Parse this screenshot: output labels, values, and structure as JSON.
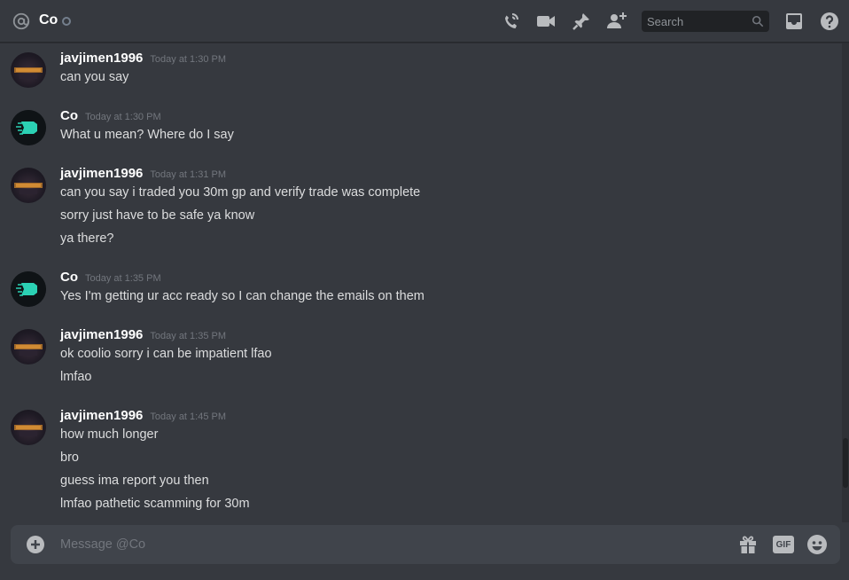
{
  "header": {
    "channel_name": "Co",
    "search_placeholder": "Search"
  },
  "messages": [
    {
      "author": "javjimen1996",
      "avatar": "jav",
      "timestamp": "Today at 1:30 PM",
      "lines": [
        "can you say"
      ]
    },
    {
      "author": "Co",
      "avatar": "co",
      "timestamp": "Today at 1:30 PM",
      "lines": [
        "What u mean? Where do I say"
      ]
    },
    {
      "author": "javjimen1996",
      "avatar": "jav",
      "timestamp": "Today at 1:31 PM",
      "lines": [
        "can you say i traded you 30m gp and verify trade was complete",
        "sorry just have to be safe ya know",
        "ya there?"
      ]
    },
    {
      "author": "Co",
      "avatar": "co",
      "timestamp": "Today at 1:35 PM",
      "lines": [
        "Yes I'm getting ur acc ready so I can change the emails on them"
      ]
    },
    {
      "author": "javjimen1996",
      "avatar": "jav",
      "timestamp": "Today at 1:35 PM",
      "lines": [
        "ok coolio sorry i can be impatient lfao",
        "lmfao"
      ]
    },
    {
      "author": "javjimen1996",
      "avatar": "jav",
      "timestamp": "Today at 1:45 PM",
      "lines": [
        "how much longer",
        "bro",
        "guess ima report you then",
        "lmfao pathetic scamming for 30m"
      ]
    }
  ],
  "composer": {
    "placeholder": "Message @Co",
    "gif_label": "GIF"
  },
  "colors": {
    "background": "#36393f",
    "composer": "#40444b",
    "username": "#ffffff",
    "timestamp": "#72767d",
    "text": "#dcddde",
    "icon": "#b9bbbe"
  },
  "icons": [
    "at-icon",
    "status-offline-icon",
    "voice-call-icon",
    "video-call-icon",
    "pin-icon",
    "add-friend-icon",
    "search-icon",
    "inbox-icon",
    "help-icon",
    "plus-circle-icon",
    "gift-icon",
    "gif-icon",
    "emoji-icon"
  ]
}
